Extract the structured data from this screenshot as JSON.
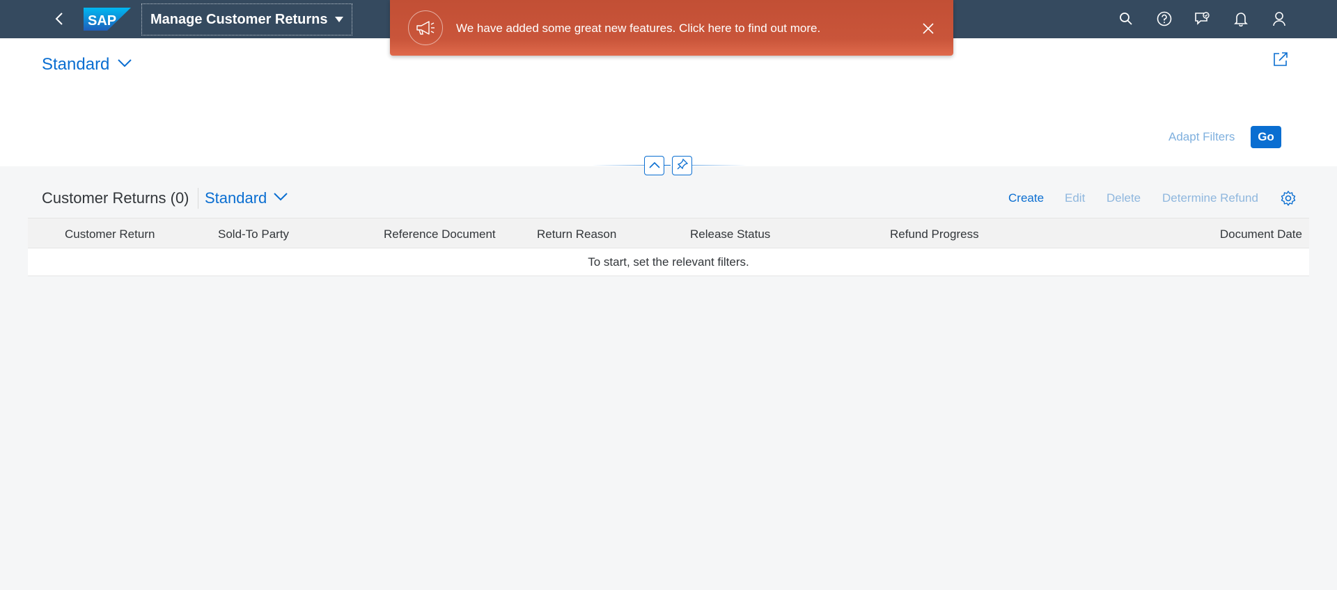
{
  "shell": {
    "logo_text": "SAP",
    "app_title": "Manage Customer Returns",
    "icons": [
      "back-icon",
      "search-icon",
      "help-icon",
      "feedback-icon",
      "notifications-icon",
      "user-icon"
    ],
    "bar_color": "#354a5f"
  },
  "announcement": {
    "message": "We have added some great new features. Click here to find out more.",
    "icon": "megaphone-icon",
    "color": "#c9553a"
  },
  "filter_bar": {
    "variant": "Standard",
    "adapt_filters": "Adapt Filters",
    "go": "Go"
  },
  "table": {
    "title": "Customer Returns (0)",
    "variant": "Standard",
    "actions": {
      "create": "Create",
      "edit": "Edit",
      "delete": "Delete",
      "determine_refund": "Determine Refund"
    },
    "columns": [
      "Customer Return",
      "Sold-To Party",
      "Reference Document",
      "Return Reason",
      "Release Status",
      "Refund Progress",
      "Document Date"
    ],
    "empty_text": "To start, set the relevant filters."
  },
  "accent_color": "#0a6ed1"
}
